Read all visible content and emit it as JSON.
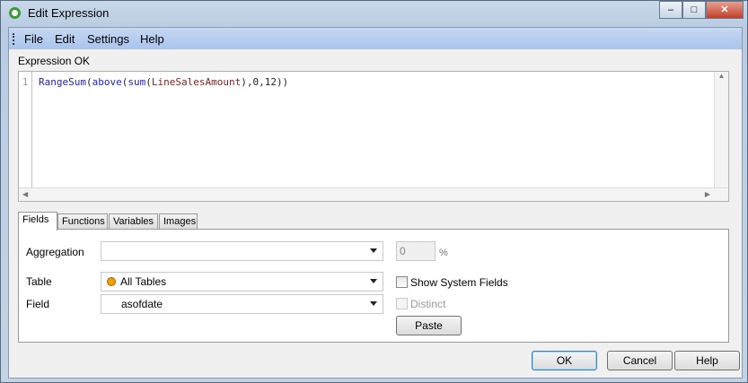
{
  "window": {
    "title": "Edit Expression",
    "minimize": "–",
    "maximize": "□",
    "close": "✕"
  },
  "menu": [
    "File",
    "Edit",
    "Settings",
    "Help"
  ],
  "status": "Expression OK",
  "editor": {
    "line_number": "1",
    "tokens": [
      {
        "t": "RangeSum",
        "c": "fn"
      },
      {
        "t": "(",
        "c": "pn"
      },
      {
        "t": "above",
        "c": "fn"
      },
      {
        "t": "(",
        "c": "pn"
      },
      {
        "t": "sum",
        "c": "fn"
      },
      {
        "t": "(",
        "c": "pn"
      },
      {
        "t": "LineSalesAmount",
        "c": "fld"
      },
      {
        "t": "),0,12))",
        "c": "pn"
      }
    ]
  },
  "tabs": [
    "Fields",
    "Functions",
    "Variables",
    "Images"
  ],
  "fields": {
    "aggregation_label": "Aggregation",
    "aggregation_value": "",
    "percent_value": "0",
    "percent_sign": "%",
    "table_label": "Table",
    "table_value": "All Tables",
    "field_label": "Field",
    "field_value": "asofdate",
    "show_system_fields": "Show System Fields",
    "distinct": "Distinct",
    "paste": "Paste"
  },
  "buttons": {
    "ok": "OK",
    "cancel": "Cancel",
    "help": "Help"
  }
}
